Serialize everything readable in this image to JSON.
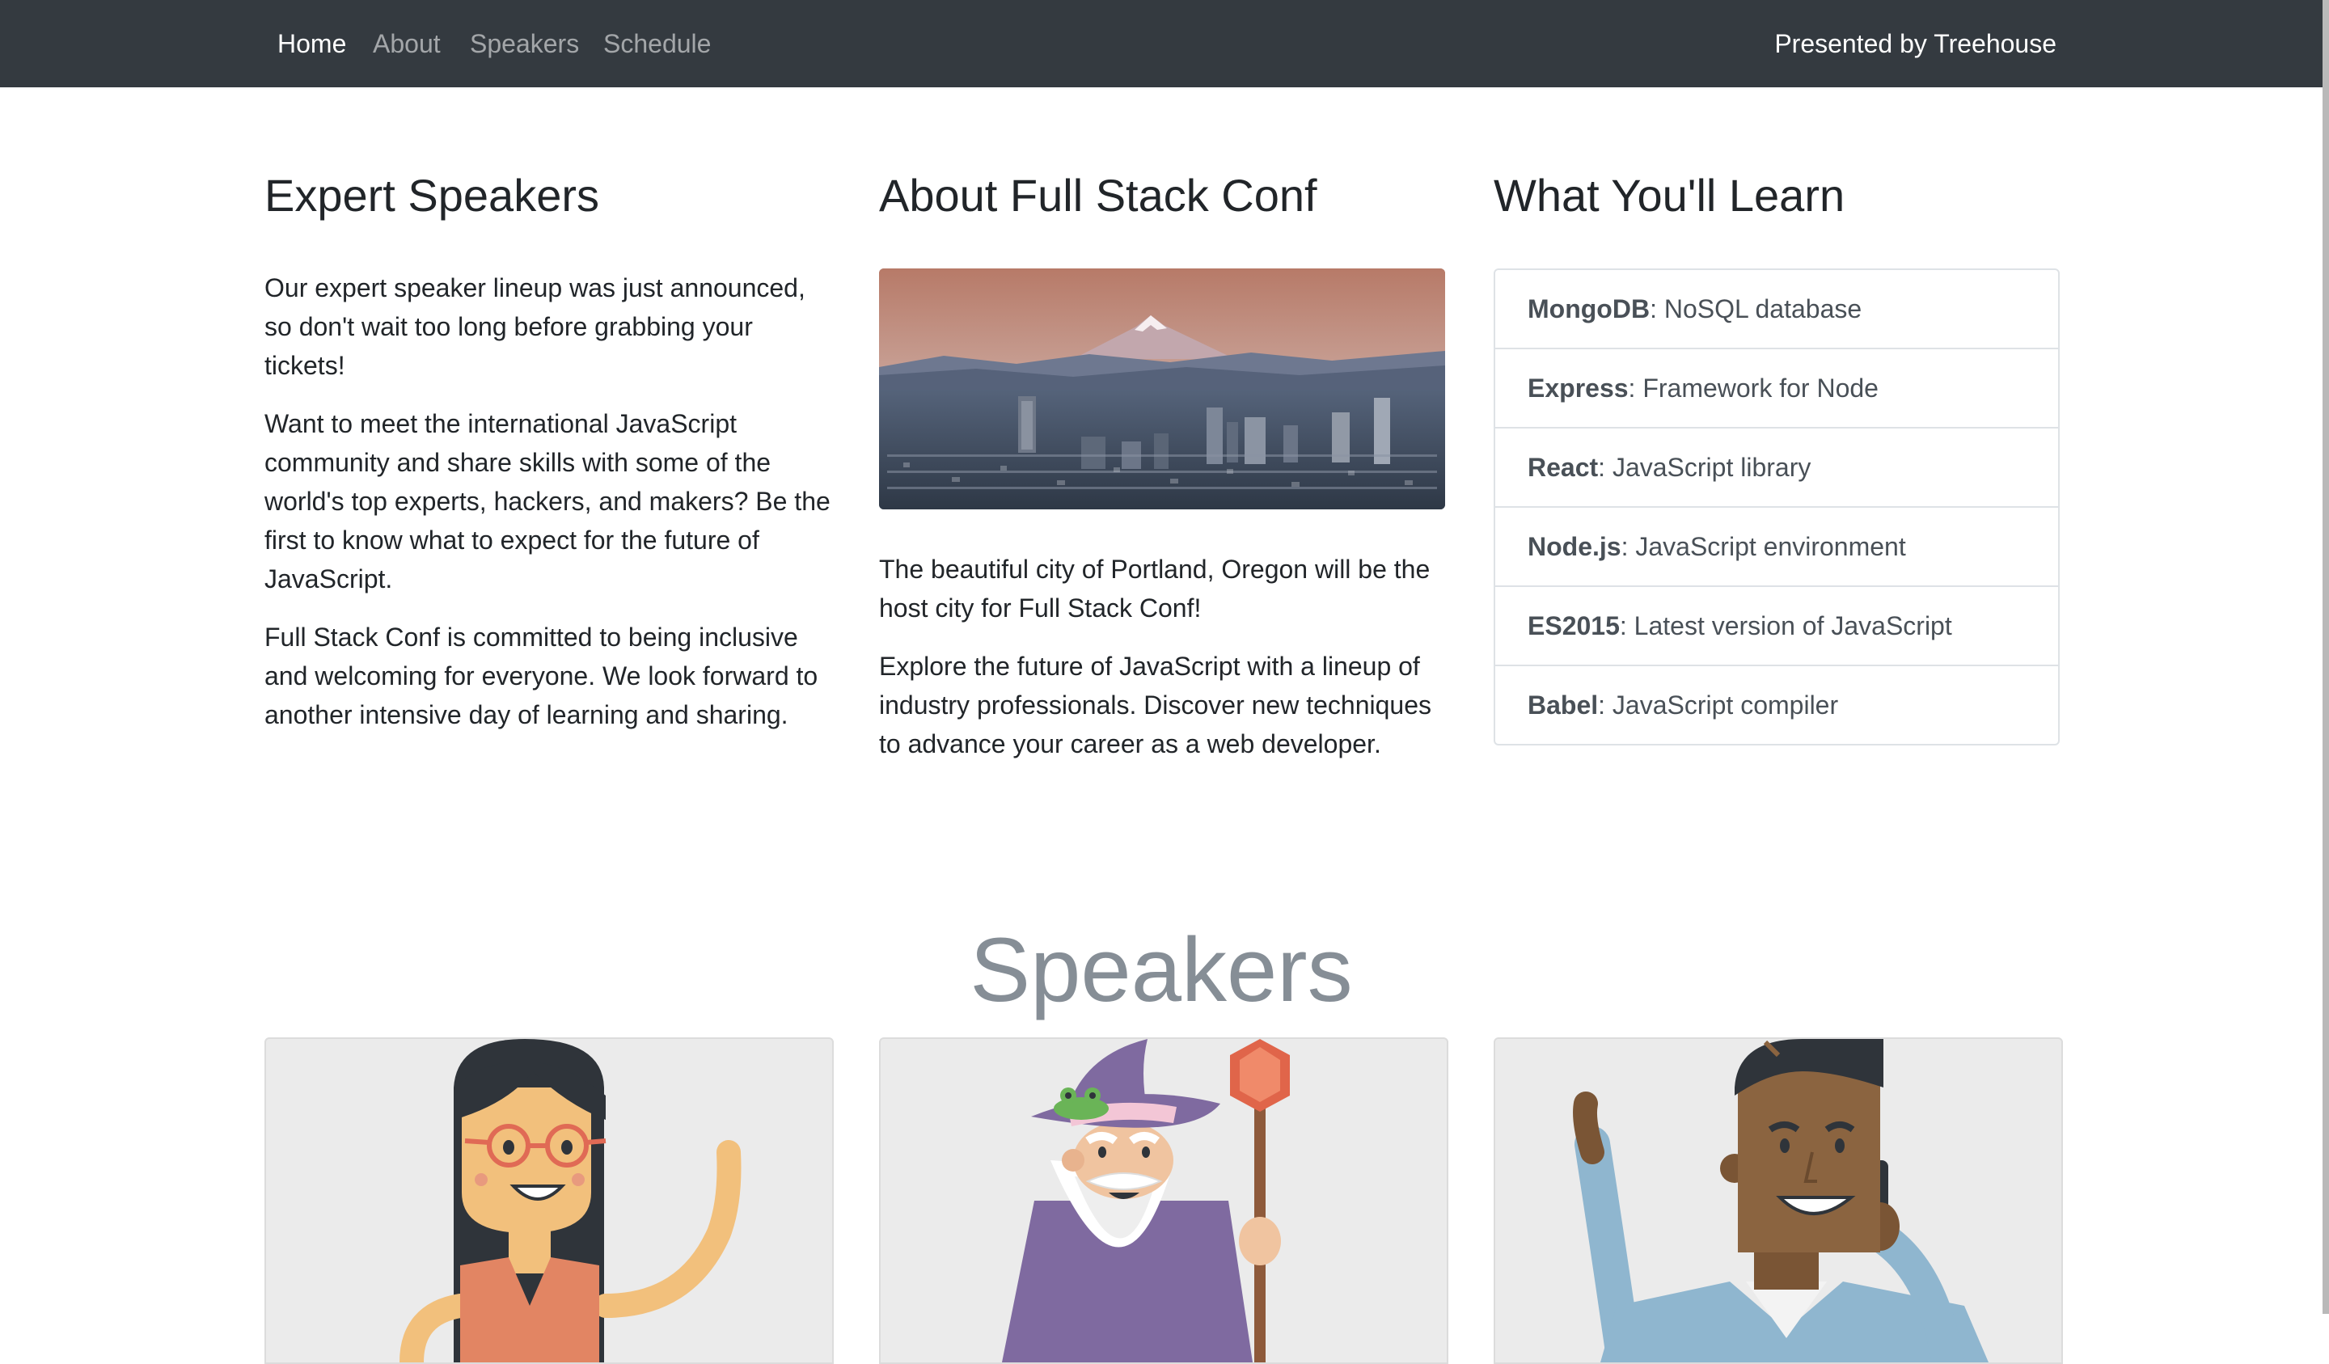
{
  "navbar": {
    "links": [
      {
        "label": "Home",
        "active": true
      },
      {
        "label": "About",
        "active": false
      },
      {
        "label": "Speakers",
        "active": false
      },
      {
        "label": "Schedule",
        "active": false
      }
    ],
    "brand": "Presented by Treehouse"
  },
  "columns": {
    "speakers": {
      "heading": "Expert Speakers",
      "paragraphs": [
        "Our expert speaker lineup was just announced, so don't wait too long before grabbing your tickets!",
        "Want to meet the international JavaScript community and share skills with some of the world's top experts, hackers, and makers? Be the first to know what to expect for the future of JavaScript.",
        "Full Stack Conf is committed to being inclusive and welcoming for everyone. We look forward to another intensive day of learning and sharing."
      ]
    },
    "about": {
      "heading": "About Full Stack Conf",
      "image_alt": "portland-city-image",
      "paragraphs": [
        "The beautiful city of Portland, Oregon will be the host city for Full Stack Conf!",
        "Explore the future of JavaScript with a lineup of industry professionals. Discover new techniques to advance your career as a web developer."
      ]
    },
    "learn": {
      "heading": "What You'll Learn",
      "items": [
        {
          "term": "MongoDB",
          "desc": ": NoSQL database"
        },
        {
          "term": "Express",
          "desc": ": Framework for Node"
        },
        {
          "term": "React",
          "desc": ": JavaScript library"
        },
        {
          "term": "Node.js",
          "desc": ": JavaScript environment"
        },
        {
          "term": "ES2015",
          "desc": ": Latest version of JavaScript"
        },
        {
          "term": "Babel",
          "desc": ": JavaScript compiler"
        }
      ]
    }
  },
  "speakers_section": {
    "title": "Speakers",
    "cards": [
      {
        "illustration": "woman-with-glasses-waving"
      },
      {
        "illustration": "wizard-with-frog-and-staff"
      },
      {
        "illustration": "man-on-phone-waving"
      }
    ]
  },
  "colors": {
    "navbar_bg": "#343a40",
    "nav_active": "#ffffff",
    "nav_inactive": "rgba(255,255,255,0.55)",
    "speakers_title": "#868e96",
    "card_bg": "#ebebeb"
  }
}
